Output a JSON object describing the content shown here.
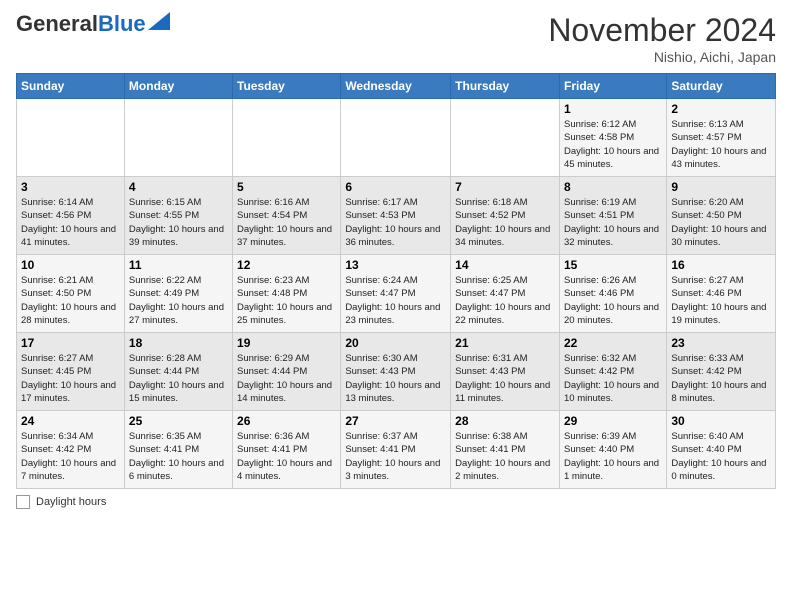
{
  "header": {
    "logo_general": "General",
    "logo_blue": "Blue",
    "month_title": "November 2024",
    "subtitle": "Nishio, Aichi, Japan"
  },
  "days_of_week": [
    "Sunday",
    "Monday",
    "Tuesday",
    "Wednesday",
    "Thursday",
    "Friday",
    "Saturday"
  ],
  "weeks": [
    [
      {
        "day": "",
        "info": ""
      },
      {
        "day": "",
        "info": ""
      },
      {
        "day": "",
        "info": ""
      },
      {
        "day": "",
        "info": ""
      },
      {
        "day": "",
        "info": ""
      },
      {
        "day": "1",
        "info": "Sunrise: 6:12 AM\nSunset: 4:58 PM\nDaylight: 10 hours and 45 minutes."
      },
      {
        "day": "2",
        "info": "Sunrise: 6:13 AM\nSunset: 4:57 PM\nDaylight: 10 hours and 43 minutes."
      }
    ],
    [
      {
        "day": "3",
        "info": "Sunrise: 6:14 AM\nSunset: 4:56 PM\nDaylight: 10 hours and 41 minutes."
      },
      {
        "day": "4",
        "info": "Sunrise: 6:15 AM\nSunset: 4:55 PM\nDaylight: 10 hours and 39 minutes."
      },
      {
        "day": "5",
        "info": "Sunrise: 6:16 AM\nSunset: 4:54 PM\nDaylight: 10 hours and 37 minutes."
      },
      {
        "day": "6",
        "info": "Sunrise: 6:17 AM\nSunset: 4:53 PM\nDaylight: 10 hours and 36 minutes."
      },
      {
        "day": "7",
        "info": "Sunrise: 6:18 AM\nSunset: 4:52 PM\nDaylight: 10 hours and 34 minutes."
      },
      {
        "day": "8",
        "info": "Sunrise: 6:19 AM\nSunset: 4:51 PM\nDaylight: 10 hours and 32 minutes."
      },
      {
        "day": "9",
        "info": "Sunrise: 6:20 AM\nSunset: 4:50 PM\nDaylight: 10 hours and 30 minutes."
      }
    ],
    [
      {
        "day": "10",
        "info": "Sunrise: 6:21 AM\nSunset: 4:50 PM\nDaylight: 10 hours and 28 minutes."
      },
      {
        "day": "11",
        "info": "Sunrise: 6:22 AM\nSunset: 4:49 PM\nDaylight: 10 hours and 27 minutes."
      },
      {
        "day": "12",
        "info": "Sunrise: 6:23 AM\nSunset: 4:48 PM\nDaylight: 10 hours and 25 minutes."
      },
      {
        "day": "13",
        "info": "Sunrise: 6:24 AM\nSunset: 4:47 PM\nDaylight: 10 hours and 23 minutes."
      },
      {
        "day": "14",
        "info": "Sunrise: 6:25 AM\nSunset: 4:47 PM\nDaylight: 10 hours and 22 minutes."
      },
      {
        "day": "15",
        "info": "Sunrise: 6:26 AM\nSunset: 4:46 PM\nDaylight: 10 hours and 20 minutes."
      },
      {
        "day": "16",
        "info": "Sunrise: 6:27 AM\nSunset: 4:46 PM\nDaylight: 10 hours and 19 minutes."
      }
    ],
    [
      {
        "day": "17",
        "info": "Sunrise: 6:27 AM\nSunset: 4:45 PM\nDaylight: 10 hours and 17 minutes."
      },
      {
        "day": "18",
        "info": "Sunrise: 6:28 AM\nSunset: 4:44 PM\nDaylight: 10 hours and 15 minutes."
      },
      {
        "day": "19",
        "info": "Sunrise: 6:29 AM\nSunset: 4:44 PM\nDaylight: 10 hours and 14 minutes."
      },
      {
        "day": "20",
        "info": "Sunrise: 6:30 AM\nSunset: 4:43 PM\nDaylight: 10 hours and 13 minutes."
      },
      {
        "day": "21",
        "info": "Sunrise: 6:31 AM\nSunset: 4:43 PM\nDaylight: 10 hours and 11 minutes."
      },
      {
        "day": "22",
        "info": "Sunrise: 6:32 AM\nSunset: 4:42 PM\nDaylight: 10 hours and 10 minutes."
      },
      {
        "day": "23",
        "info": "Sunrise: 6:33 AM\nSunset: 4:42 PM\nDaylight: 10 hours and 8 minutes."
      }
    ],
    [
      {
        "day": "24",
        "info": "Sunrise: 6:34 AM\nSunset: 4:42 PM\nDaylight: 10 hours and 7 minutes."
      },
      {
        "day": "25",
        "info": "Sunrise: 6:35 AM\nSunset: 4:41 PM\nDaylight: 10 hours and 6 minutes."
      },
      {
        "day": "26",
        "info": "Sunrise: 6:36 AM\nSunset: 4:41 PM\nDaylight: 10 hours and 4 minutes."
      },
      {
        "day": "27",
        "info": "Sunrise: 6:37 AM\nSunset: 4:41 PM\nDaylight: 10 hours and 3 minutes."
      },
      {
        "day": "28",
        "info": "Sunrise: 6:38 AM\nSunset: 4:41 PM\nDaylight: 10 hours and 2 minutes."
      },
      {
        "day": "29",
        "info": "Sunrise: 6:39 AM\nSunset: 4:40 PM\nDaylight: 10 hours and 1 minute."
      },
      {
        "day": "30",
        "info": "Sunrise: 6:40 AM\nSunset: 4:40 PM\nDaylight: 10 hours and 0 minutes."
      }
    ]
  ],
  "footer": {
    "label": "Daylight hours"
  }
}
